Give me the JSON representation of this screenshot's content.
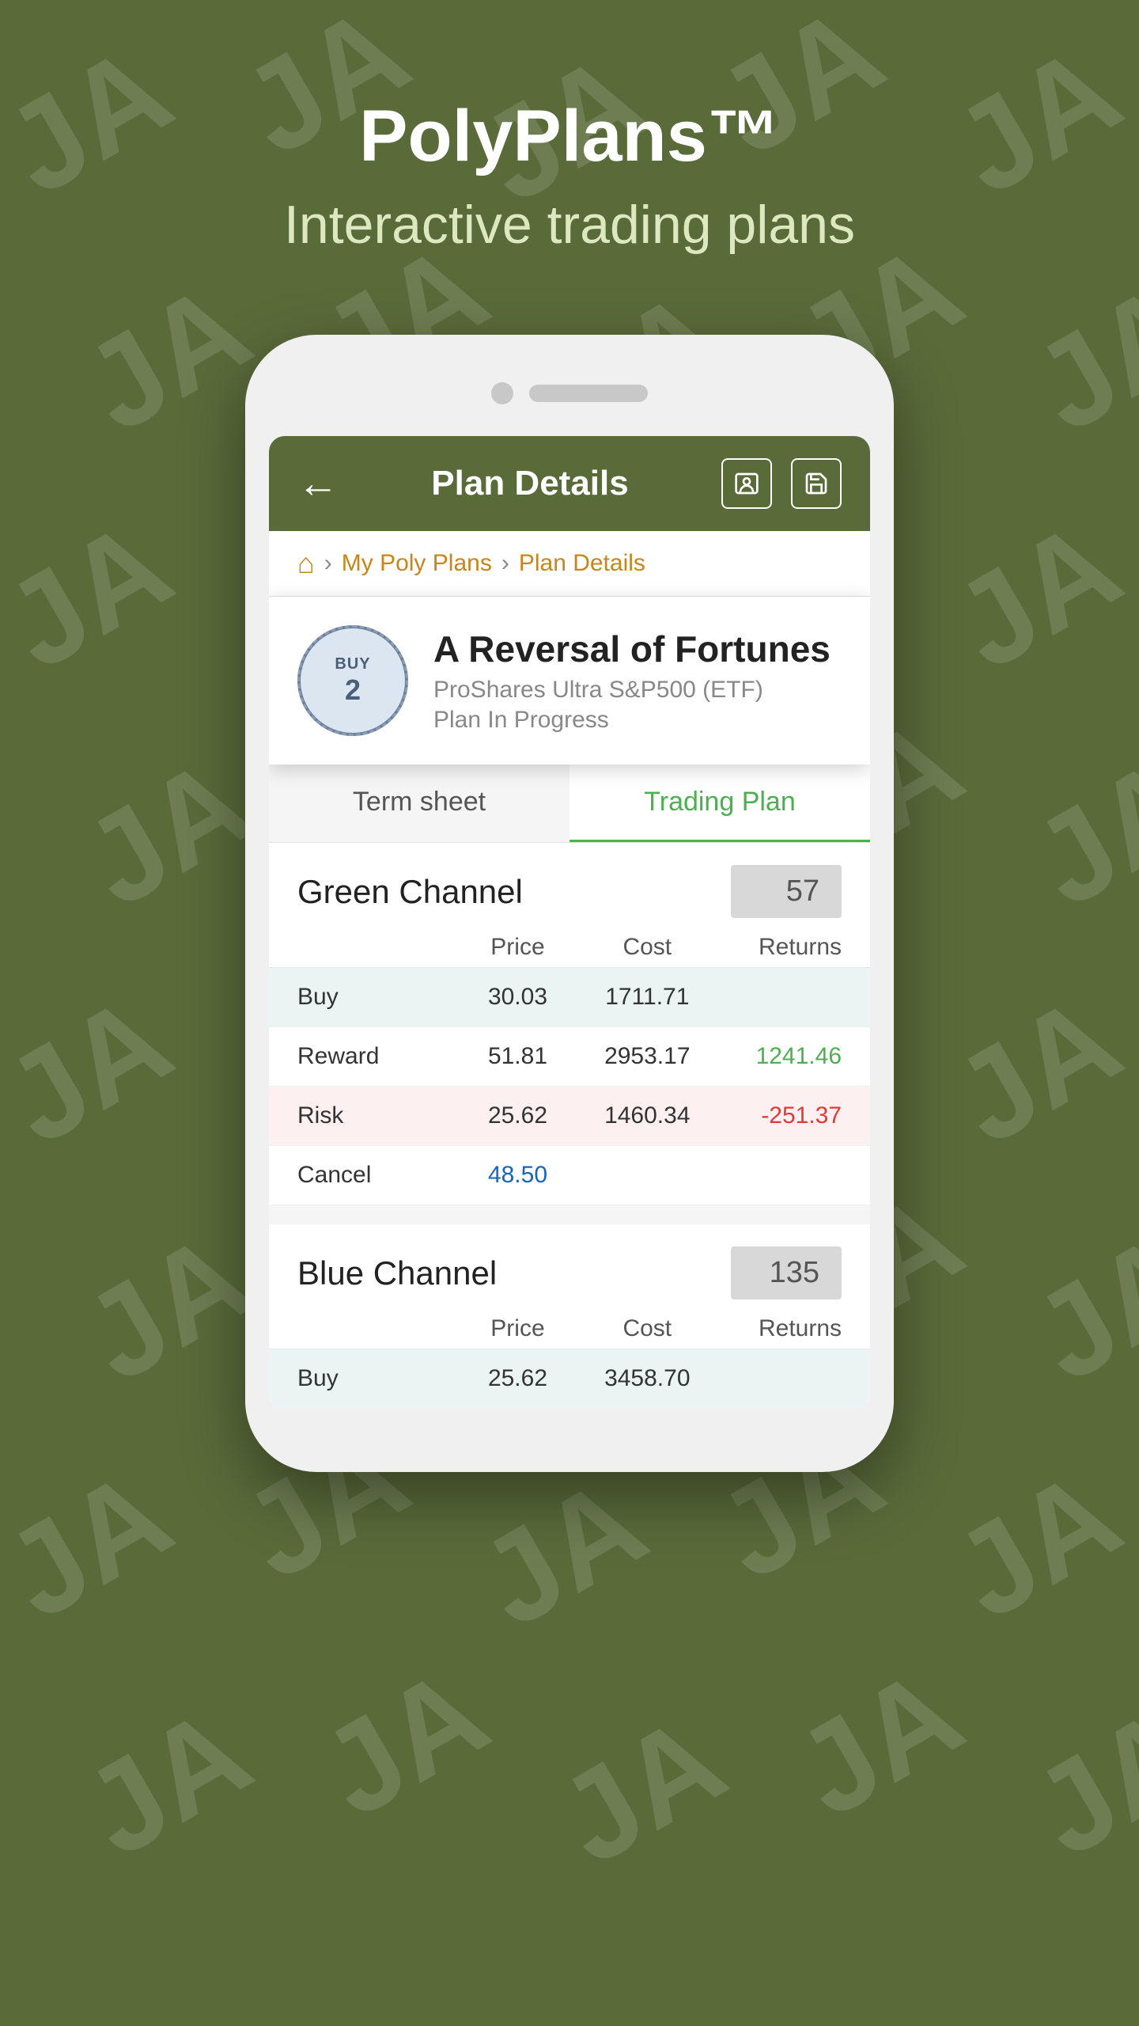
{
  "app": {
    "title": "PolyPlans™",
    "subtitle": "Interactive trading plans"
  },
  "appbar": {
    "back_icon": "←",
    "title": "Plan Details",
    "contact_icon": "👤",
    "save_icon": "💾"
  },
  "breadcrumb": {
    "home_icon": "⌂",
    "separator": "›",
    "link": "My Poly Plans",
    "current": "Plan Details"
  },
  "plan": {
    "badge_text": "BUY",
    "badge_num": "2",
    "name": "A Reversal of Fortunes",
    "subtitle": "ProShares Ultra S&P500 (ETF)",
    "status": "Plan In Progress"
  },
  "tabs": [
    {
      "label": "Term sheet",
      "active": false
    },
    {
      "label": "Trading Plan",
      "active": true
    }
  ],
  "green_channel": {
    "label": "Green Channel",
    "value": "57",
    "col_headers": {
      "label": "",
      "price": "Price",
      "cost": "Cost",
      "returns": "Returns"
    },
    "rows": [
      {
        "type": "Buy",
        "price": "30.03",
        "cost": "1711.71",
        "returns": "",
        "style": "buy"
      },
      {
        "type": "Reward",
        "price": "51.81",
        "cost": "2953.17",
        "returns": "1241.46",
        "returns_style": "positive",
        "style": "reward"
      },
      {
        "type": "Risk",
        "price": "25.62",
        "cost": "1460.34",
        "returns": "-251.37",
        "returns_style": "negative",
        "style": "risk"
      },
      {
        "type": "Cancel",
        "price": "48.50",
        "cost": "",
        "returns": "",
        "price_style": "blue",
        "style": "cancel"
      }
    ]
  },
  "blue_channel": {
    "label": "Blue Channel",
    "value": "135",
    "col_headers": {
      "label": "",
      "price": "Price",
      "cost": "Cost",
      "returns": "Returns"
    },
    "rows": [
      {
        "type": "Buy",
        "price": "25.62",
        "cost": "3458.70",
        "returns": "",
        "style": "buy"
      }
    ]
  },
  "colors": {
    "background": "#5a6b3a",
    "appbar": "#5a6b3a",
    "active_tab": "#4caf50",
    "positive_returns": "#4caf50",
    "negative_returns": "#e53935",
    "price_blue": "#1565c0"
  }
}
